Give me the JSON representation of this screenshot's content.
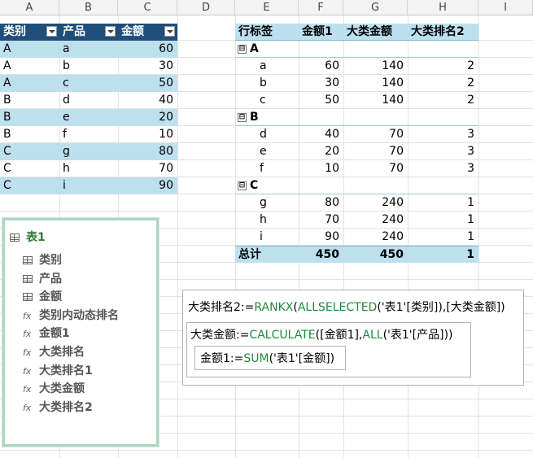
{
  "columns": [
    "A",
    "B",
    "C",
    "D",
    "E",
    "F",
    "G",
    "H",
    "I"
  ],
  "table1": {
    "headers": [
      "类别",
      "产品",
      "金额"
    ],
    "rows": [
      [
        "A",
        "a",
        "60"
      ],
      [
        "A",
        "b",
        "30"
      ],
      [
        "A",
        "c",
        "50"
      ],
      [
        "B",
        "d",
        "40"
      ],
      [
        "B",
        "e",
        "20"
      ],
      [
        "B",
        "f",
        "10"
      ],
      [
        "C",
        "g",
        "80"
      ],
      [
        "C",
        "h",
        "70"
      ],
      [
        "C",
        "i",
        "90"
      ]
    ]
  },
  "pivot": {
    "headers": [
      "行标签",
      "金额1",
      "大类金额",
      "大类排名2"
    ],
    "groups": [
      {
        "label": "A",
        "rows": [
          [
            "a",
            "60",
            "140",
            "2"
          ],
          [
            "b",
            "30",
            "140",
            "2"
          ],
          [
            "c",
            "50",
            "140",
            "2"
          ]
        ]
      },
      {
        "label": "B",
        "rows": [
          [
            "d",
            "40",
            "70",
            "3"
          ],
          [
            "e",
            "20",
            "70",
            "3"
          ],
          [
            "f",
            "10",
            "70",
            "3"
          ]
        ]
      },
      {
        "label": "C",
        "rows": [
          [
            "g",
            "80",
            "240",
            "1"
          ],
          [
            "h",
            "70",
            "240",
            "1"
          ],
          [
            "i",
            "90",
            "240",
            "1"
          ]
        ]
      }
    ],
    "total": [
      "总计",
      "450",
      "450",
      "1"
    ],
    "expander_glyph": "⊟"
  },
  "field_list": {
    "table_name": "表1",
    "fields": [
      {
        "label": "类别",
        "icon": "table-field-icon"
      },
      {
        "label": "产品",
        "icon": "table-field-icon"
      },
      {
        "label": "金额",
        "icon": "table-field-icon"
      },
      {
        "label": "类别内动态排名",
        "icon": "measure-icon"
      },
      {
        "label": "金额1",
        "icon": "measure-icon"
      },
      {
        "label": "大类排名",
        "icon": "measure-icon"
      },
      {
        "label": "大类排名1",
        "icon": "measure-icon"
      },
      {
        "label": "大类金额",
        "icon": "measure-icon"
      },
      {
        "label": "大类排名2",
        "icon": "measure-icon"
      }
    ],
    "measure_glyph": "fx"
  },
  "formulas": {
    "f1": {
      "name": "大类排名2:=",
      "fn1": "RANKX",
      "p1": "(",
      "fn2": "ALLSELECTED",
      "rest": "('表1'[类别]),[大类金额])"
    },
    "f2": {
      "name": "大类金额:=",
      "fn1": "CALCULATE",
      "p1": "([金额1],",
      "fn2": "ALL",
      "rest": "('表1'[产品]))"
    },
    "f3": {
      "name": "金额1:=",
      "fn1": "SUM",
      "rest": "('表1'[金额])"
    }
  },
  "colors": {
    "table_header": "#1f4e79",
    "band": "#bde0ef",
    "formula_keyword": "#1e8c3a",
    "field_list_border": "#a8d8bf"
  }
}
